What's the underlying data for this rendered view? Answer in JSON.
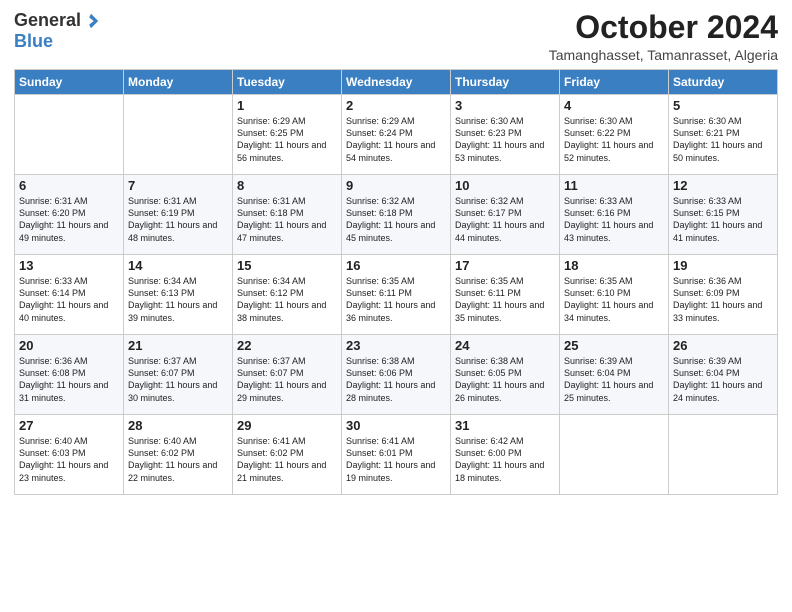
{
  "logo": {
    "general": "General",
    "blue": "Blue"
  },
  "title": "October 2024",
  "location": "Tamanghasset, Tamanrasset, Algeria",
  "days_of_week": [
    "Sunday",
    "Monday",
    "Tuesday",
    "Wednesday",
    "Thursday",
    "Friday",
    "Saturday"
  ],
  "weeks": [
    [
      {
        "day": "",
        "info": ""
      },
      {
        "day": "",
        "info": ""
      },
      {
        "day": "1",
        "info": "Sunrise: 6:29 AM\nSunset: 6:25 PM\nDaylight: 11 hours and 56 minutes."
      },
      {
        "day": "2",
        "info": "Sunrise: 6:29 AM\nSunset: 6:24 PM\nDaylight: 11 hours and 54 minutes."
      },
      {
        "day": "3",
        "info": "Sunrise: 6:30 AM\nSunset: 6:23 PM\nDaylight: 11 hours and 53 minutes."
      },
      {
        "day": "4",
        "info": "Sunrise: 6:30 AM\nSunset: 6:22 PM\nDaylight: 11 hours and 52 minutes."
      },
      {
        "day": "5",
        "info": "Sunrise: 6:30 AM\nSunset: 6:21 PM\nDaylight: 11 hours and 50 minutes."
      }
    ],
    [
      {
        "day": "6",
        "info": "Sunrise: 6:31 AM\nSunset: 6:20 PM\nDaylight: 11 hours and 49 minutes."
      },
      {
        "day": "7",
        "info": "Sunrise: 6:31 AM\nSunset: 6:19 PM\nDaylight: 11 hours and 48 minutes."
      },
      {
        "day": "8",
        "info": "Sunrise: 6:31 AM\nSunset: 6:18 PM\nDaylight: 11 hours and 47 minutes."
      },
      {
        "day": "9",
        "info": "Sunrise: 6:32 AM\nSunset: 6:18 PM\nDaylight: 11 hours and 45 minutes."
      },
      {
        "day": "10",
        "info": "Sunrise: 6:32 AM\nSunset: 6:17 PM\nDaylight: 11 hours and 44 minutes."
      },
      {
        "day": "11",
        "info": "Sunrise: 6:33 AM\nSunset: 6:16 PM\nDaylight: 11 hours and 43 minutes."
      },
      {
        "day": "12",
        "info": "Sunrise: 6:33 AM\nSunset: 6:15 PM\nDaylight: 11 hours and 41 minutes."
      }
    ],
    [
      {
        "day": "13",
        "info": "Sunrise: 6:33 AM\nSunset: 6:14 PM\nDaylight: 11 hours and 40 minutes."
      },
      {
        "day": "14",
        "info": "Sunrise: 6:34 AM\nSunset: 6:13 PM\nDaylight: 11 hours and 39 minutes."
      },
      {
        "day": "15",
        "info": "Sunrise: 6:34 AM\nSunset: 6:12 PM\nDaylight: 11 hours and 38 minutes."
      },
      {
        "day": "16",
        "info": "Sunrise: 6:35 AM\nSunset: 6:11 PM\nDaylight: 11 hours and 36 minutes."
      },
      {
        "day": "17",
        "info": "Sunrise: 6:35 AM\nSunset: 6:11 PM\nDaylight: 11 hours and 35 minutes."
      },
      {
        "day": "18",
        "info": "Sunrise: 6:35 AM\nSunset: 6:10 PM\nDaylight: 11 hours and 34 minutes."
      },
      {
        "day": "19",
        "info": "Sunrise: 6:36 AM\nSunset: 6:09 PM\nDaylight: 11 hours and 33 minutes."
      }
    ],
    [
      {
        "day": "20",
        "info": "Sunrise: 6:36 AM\nSunset: 6:08 PM\nDaylight: 11 hours and 31 minutes."
      },
      {
        "day": "21",
        "info": "Sunrise: 6:37 AM\nSunset: 6:07 PM\nDaylight: 11 hours and 30 minutes."
      },
      {
        "day": "22",
        "info": "Sunrise: 6:37 AM\nSunset: 6:07 PM\nDaylight: 11 hours and 29 minutes."
      },
      {
        "day": "23",
        "info": "Sunrise: 6:38 AM\nSunset: 6:06 PM\nDaylight: 11 hours and 28 minutes."
      },
      {
        "day": "24",
        "info": "Sunrise: 6:38 AM\nSunset: 6:05 PM\nDaylight: 11 hours and 26 minutes."
      },
      {
        "day": "25",
        "info": "Sunrise: 6:39 AM\nSunset: 6:04 PM\nDaylight: 11 hours and 25 minutes."
      },
      {
        "day": "26",
        "info": "Sunrise: 6:39 AM\nSunset: 6:04 PM\nDaylight: 11 hours and 24 minutes."
      }
    ],
    [
      {
        "day": "27",
        "info": "Sunrise: 6:40 AM\nSunset: 6:03 PM\nDaylight: 11 hours and 23 minutes."
      },
      {
        "day": "28",
        "info": "Sunrise: 6:40 AM\nSunset: 6:02 PM\nDaylight: 11 hours and 22 minutes."
      },
      {
        "day": "29",
        "info": "Sunrise: 6:41 AM\nSunset: 6:02 PM\nDaylight: 11 hours and 21 minutes."
      },
      {
        "day": "30",
        "info": "Sunrise: 6:41 AM\nSunset: 6:01 PM\nDaylight: 11 hours and 19 minutes."
      },
      {
        "day": "31",
        "info": "Sunrise: 6:42 AM\nSunset: 6:00 PM\nDaylight: 11 hours and 18 minutes."
      },
      {
        "day": "",
        "info": ""
      },
      {
        "day": "",
        "info": ""
      }
    ]
  ]
}
